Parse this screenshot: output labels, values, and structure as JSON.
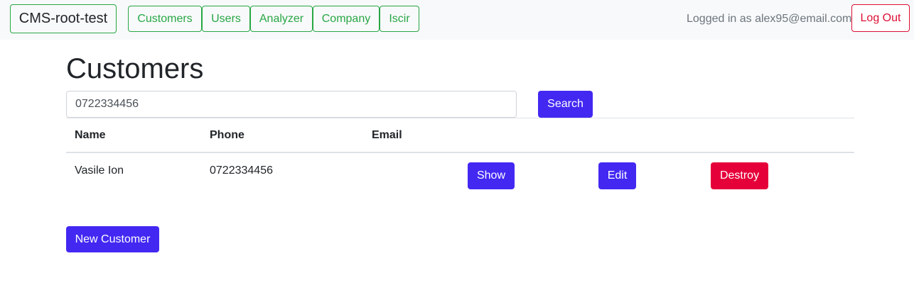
{
  "navbar": {
    "brand": "CMS-root-test",
    "links": [
      {
        "label": "Customers"
      },
      {
        "label": "Users"
      },
      {
        "label": "Analyzer"
      },
      {
        "label": "Company"
      },
      {
        "label": "Iscir"
      }
    ],
    "logged_in_text": "Logged in as alex95@email.com",
    "logout_label": "Log Out"
  },
  "main": {
    "title": "Customers",
    "search": {
      "value": "0722334456",
      "button_label": "Search"
    },
    "table": {
      "headers": [
        "Name",
        "Phone",
        "Email"
      ],
      "rows": [
        {
          "name": "Vasile Ion",
          "phone": "0722334456",
          "email": "",
          "show_label": "Show",
          "edit_label": "Edit",
          "destroy_label": "Destroy"
        }
      ]
    },
    "new_button_label": "New Customer"
  },
  "colors": {
    "nav_accent": "#28a745",
    "primary": "#4328f2",
    "danger": "#e6003a"
  }
}
